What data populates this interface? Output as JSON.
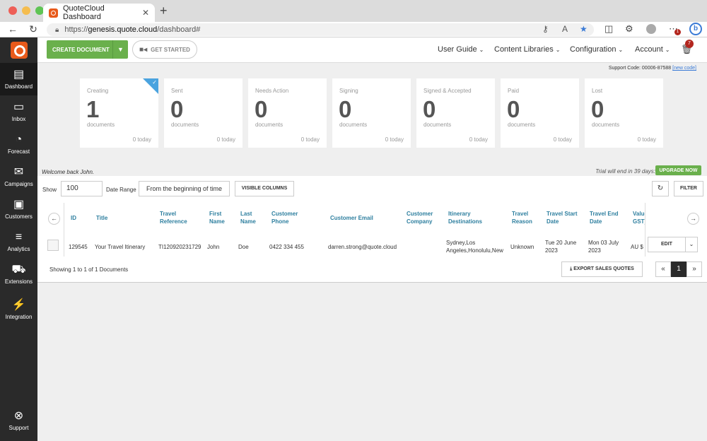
{
  "browser": {
    "tab_title": "QuoteCloud Dashboard",
    "url_prefix": "https://",
    "url_host": "genesis.quote.cloud",
    "url_path": "/dashboard#",
    "notif_count": "1"
  },
  "topnav": {
    "create_label": "CREATE DOCUMENT",
    "started_label": "GET STARTED",
    "menus": [
      "User Guide",
      "Content Libraries",
      "Configuration",
      "Account"
    ],
    "trash_count": "7"
  },
  "sidebar": {
    "items": [
      {
        "label": "Dashboard",
        "icon": "archive-box-icon"
      },
      {
        "label": "Inbox",
        "icon": "inbox-icon"
      },
      {
        "label": "Forecast",
        "icon": "gauge-icon"
      },
      {
        "label": "Campaigns",
        "icon": "envelope-icon"
      },
      {
        "label": "Customers",
        "icon": "contact-card-icon"
      },
      {
        "label": "Analytics",
        "icon": "bar-chart-icon"
      },
      {
        "label": "Extensions",
        "icon": "cart-icon"
      },
      {
        "label": "Integration",
        "icon": "plug-icon"
      }
    ],
    "support_label": "Support"
  },
  "support_code": {
    "text": "Support Code: 00006-87588",
    "link": "[new code]"
  },
  "cards": [
    {
      "label": "Creating",
      "count": "1",
      "unit": "documents",
      "today": "0 today"
    },
    {
      "label": "Sent",
      "count": "0",
      "unit": "documents",
      "today": "0 today"
    },
    {
      "label": "Needs Action",
      "count": "0",
      "unit": "documents",
      "today": "0 today"
    },
    {
      "label": "Signing",
      "count": "0",
      "unit": "documents",
      "today": "0 today"
    },
    {
      "label": "Signed & Accepted",
      "count": "0",
      "unit": "documents",
      "today": "0 today"
    },
    {
      "label": "Paid",
      "count": "0",
      "unit": "documents",
      "today": "0 today"
    },
    {
      "label": "Lost",
      "count": "0",
      "unit": "documents",
      "today": "0 today"
    }
  ],
  "welcome": "Welcome back John.",
  "trial": "Trial will end in 39 days:",
  "upgrade_label": "UPGRADE NOW",
  "toolbar": {
    "show_label": "Show",
    "show_value": "100",
    "date_range_label": "Date Range",
    "date_range_value": "From the beginning of time",
    "visible_columns": "VISIBLE COLUMNS",
    "filter": "FILTER"
  },
  "table": {
    "headers": [
      "ID",
      "Title",
      "Travel Reference",
      "First Name",
      "Last Name",
      "Customer Phone",
      "Customer Email",
      "Customer Company",
      "Itinerary Destinations",
      "Travel Reason",
      "Travel Start Date",
      "Travel End Date",
      "Value GST)"
    ],
    "row": [
      "129545",
      "Your Travel Itinerary",
      "TI120920231729",
      "John",
      "Doe",
      "0422 334 455",
      "darren.strong@quote.cloud",
      "",
      "Sydney,Los Angeles,Honolulu,New",
      "Unknown",
      "Tue 20 June 2023",
      "Mon 03 July 2023",
      "AU $"
    ],
    "edit_label": "EDIT"
  },
  "footer": {
    "showing": "Showing 1 to 1 of 1 Documents",
    "export": "EXPORT SALES QUOTES",
    "page": "1"
  },
  "colors": {
    "brand_orange": "#e85a1b",
    "accent_green": "#6ab04c",
    "header_blue": "#2e7f9f",
    "sidebar": "#2a2a2a"
  }
}
